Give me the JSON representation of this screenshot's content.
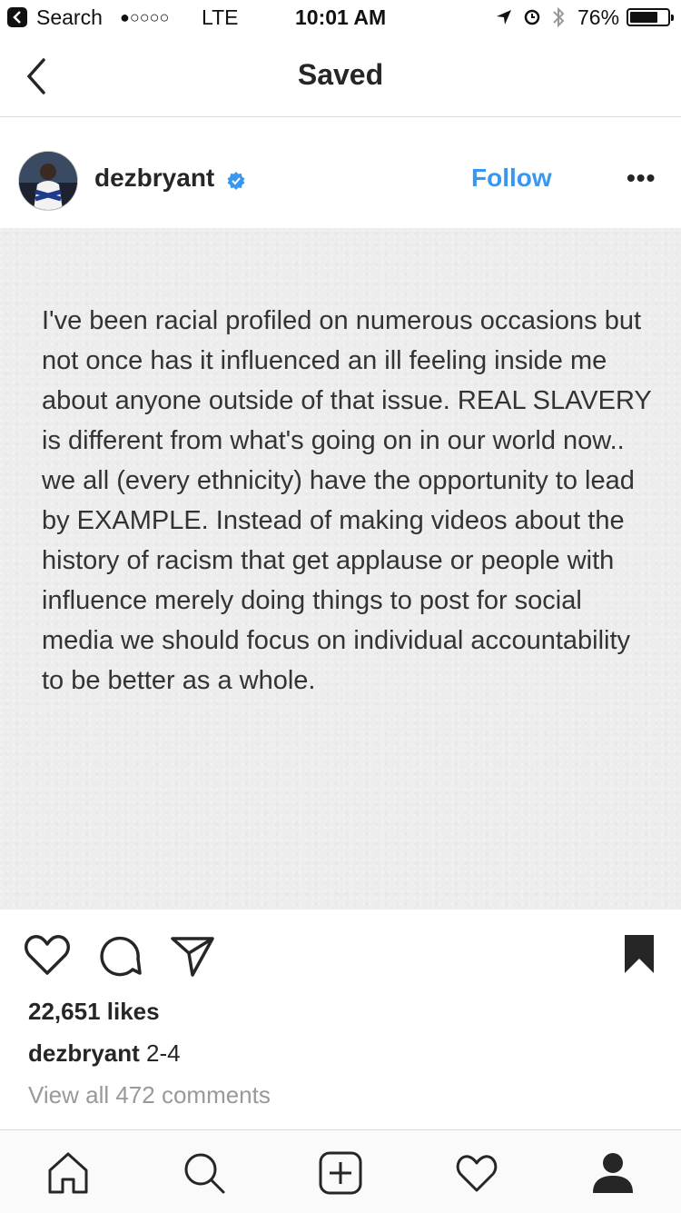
{
  "status_bar": {
    "back_app": "Search",
    "signal": "●○○○○",
    "network": "LTE",
    "time": "10:01 AM",
    "battery": "76%",
    "battery_level": 0.76
  },
  "nav": {
    "title": "Saved"
  },
  "post": {
    "username": "dezbryant",
    "verified": true,
    "follow_label": "Follow",
    "more_label": "•••",
    "quote_text": "I've been racial profiled on numerous occasions but not once has it influenced an ill feeling inside me about anyone outside of that issue. REAL SLAVERY is different from what's going on in our world now.. we all (every ethnicity) have the opportunity to lead by EXAMPLE. Instead of making videos about the history of racism that get applause or people with influence merely doing things to post for social media we should focus on individual accountability to be better as a whole.",
    "likes": "22,651 likes",
    "caption_user": "dezbryant",
    "caption_text": "2-4",
    "view_comments": "View all 472 comments"
  },
  "icons": {
    "like": "heart-icon",
    "comment": "comment-icon",
    "share": "paper-plane-icon",
    "save": "bookmark-icon",
    "home": "home-icon",
    "search": "search-icon",
    "add": "add-icon",
    "activity": "heart-icon",
    "profile": "profile-icon"
  },
  "colors": {
    "link": "#3897f0",
    "text": "#262626",
    "muted": "#999999"
  }
}
